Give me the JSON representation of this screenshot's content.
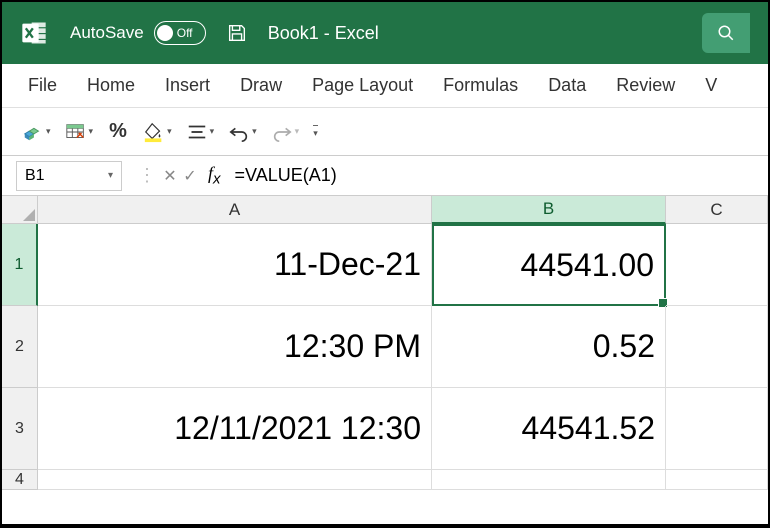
{
  "titlebar": {
    "autosave_label": "AutoSave",
    "autosave_state": "Off",
    "doc_title": "Book1 - Excel"
  },
  "ribbon": {
    "tabs": [
      "File",
      "Home",
      "Insert",
      "Draw",
      "Page Layout",
      "Formulas",
      "Data",
      "Review",
      "V"
    ]
  },
  "formula_bar": {
    "name_box": "B1",
    "formula": "=VALUE(A1)"
  },
  "columns": [
    "A",
    "B",
    "C"
  ],
  "rows": [
    "1",
    "2",
    "3",
    "4"
  ],
  "cells": {
    "A1": "11-Dec-21",
    "B1": "44541.00",
    "A2": "12:30 PM",
    "B2": "0.52",
    "A3": "12/11/2021 12:30",
    "B3": "44541.52"
  },
  "active_cell": "B1",
  "qat": {
    "percent": "%"
  }
}
